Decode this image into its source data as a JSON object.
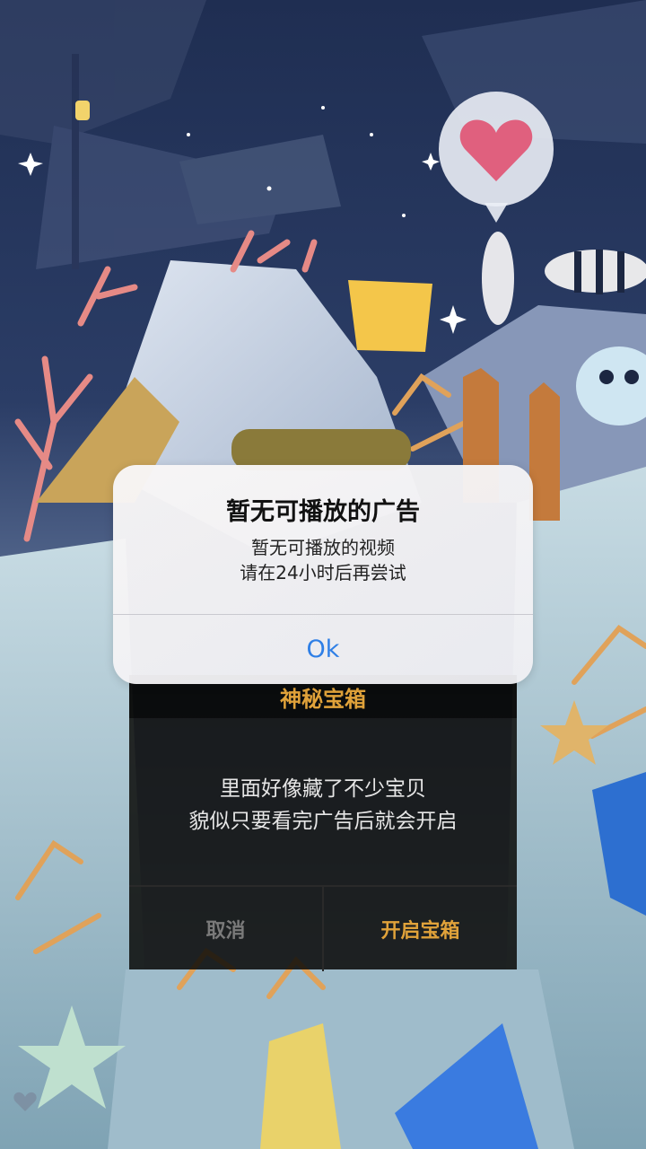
{
  "alert": {
    "title": "暂无可播放的广告",
    "message_line1": "暂无可播放的视频",
    "message_line2": "请在24小时后再尝试",
    "ok_label": "Ok"
  },
  "chest_dialog": {
    "title": "神秘宝箱",
    "message_line1": "里面好像藏了不少宝贝",
    "message_line2": "貌似只要看完广告后就会开启",
    "cancel_label": "取消",
    "open_label": "开启宝箱"
  },
  "colors": {
    "accent_gold": "#e0a23a",
    "ios_blue": "#2f7fe6",
    "heart_pink": "#e0607e"
  },
  "icons": {
    "speech_bubble": "heart-icon",
    "corner": "heart-outline-icon"
  }
}
